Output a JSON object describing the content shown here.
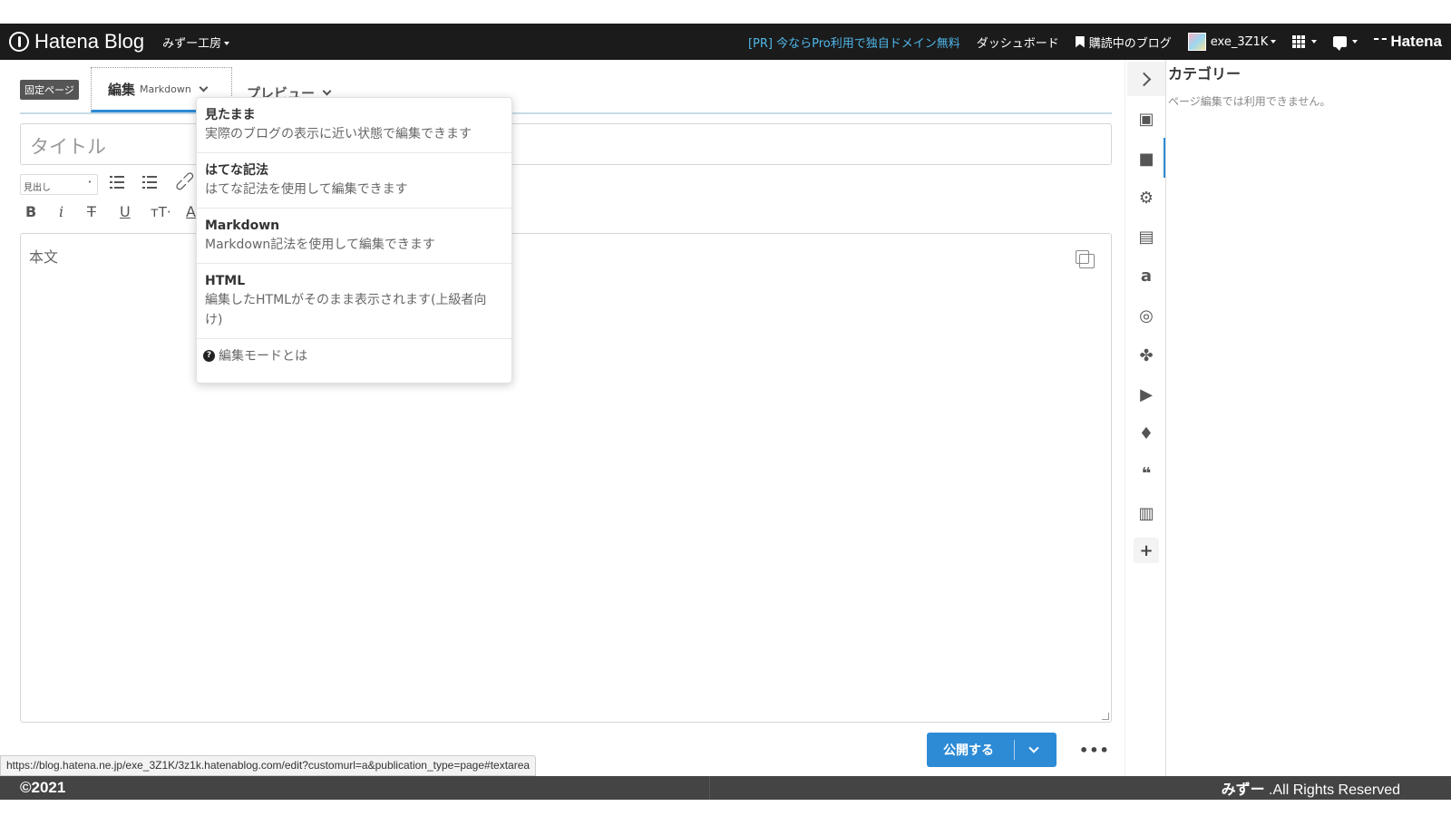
{
  "header": {
    "logo_text": "Hatena Blog",
    "blog_name": "みずー工房",
    "pr_link": "[PR] 今ならPro利用で独自ドメイン無料",
    "dashboard": "ダッシュボード",
    "subscribed": "購読中のブログ",
    "username": "exe_3Z1K",
    "brand": "Hatena"
  },
  "editor": {
    "page_badge": "固定ページ",
    "tab_edit": "編集",
    "tab_edit_mode": "Markdown",
    "tab_preview": "プレビュー",
    "title_placeholder": "タイトル",
    "heading_select": "見出し",
    "body_placeholder": "本文"
  },
  "edit_mode_menu": {
    "items": [
      {
        "title": "見たまま",
        "desc": "実際のブログの表示に近い状態で編集できます"
      },
      {
        "title": "はてな記法",
        "desc": "はてな記法を使用して編集できます"
      },
      {
        "title": "Markdown",
        "desc": "Markdown記法を使用して編集できます"
      },
      {
        "title": "HTML",
        "desc": "編集したHTMLがそのまま表示されます(上級者向け)"
      }
    ],
    "help": "編集モードとは"
  },
  "actions": {
    "publish": "公開する",
    "more": "•••"
  },
  "toolbar_icons": [
    "photo-icon",
    "folder-icon",
    "gear-icon",
    "document-icon",
    "amazon-icon",
    "instagram-icon",
    "pinwheel-icon",
    "youtube-icon",
    "twitter-icon",
    "quote-icon",
    "clipboard-icon",
    "plus-icon"
  ],
  "side_panel": {
    "title": "カテゴリー",
    "note": "ページ編集では利用できません。"
  },
  "status_url": "https://blog.hatena.ne.jp/exe_3Z1K/3z1k.hatenablog.com/edit?customurl=a&publication_type=page#textarea",
  "footer": {
    "copyright": "©2021",
    "owner": "みずー",
    "rights": " .All Rights Reserved"
  },
  "colors": {
    "accent": "#2d8bd6",
    "topbar": "#1b1b1b",
    "pr_link": "#4fb7ea",
    "footer": "#444444"
  }
}
